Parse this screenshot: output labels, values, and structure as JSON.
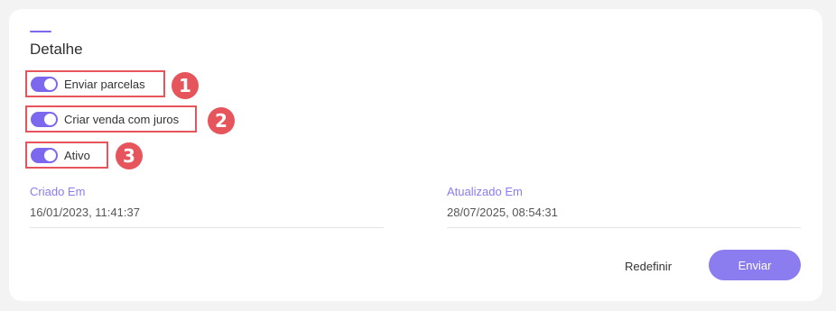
{
  "detail": {
    "title": "Detalhe",
    "toggles": [
      {
        "label": "Enviar parcelas",
        "enabled": true,
        "badge": "1"
      },
      {
        "label": "Criar venda com juros",
        "enabled": true,
        "badge": "2"
      },
      {
        "label": "Ativo",
        "enabled": true,
        "badge": "3"
      }
    ],
    "created": {
      "label": "Criado Em",
      "value": "16/01/2023, 11:41:37"
    },
    "updated": {
      "label": "Atualizado Em",
      "value": "28/07/2025, 08:54:31"
    },
    "actions": {
      "reset_label": "Redefinir",
      "submit_label": "Enviar"
    }
  },
  "colors": {
    "accent": "#7b68ee",
    "button": "#8b7cf0",
    "highlight": "#e5555b",
    "background": "#f3f3f3"
  }
}
